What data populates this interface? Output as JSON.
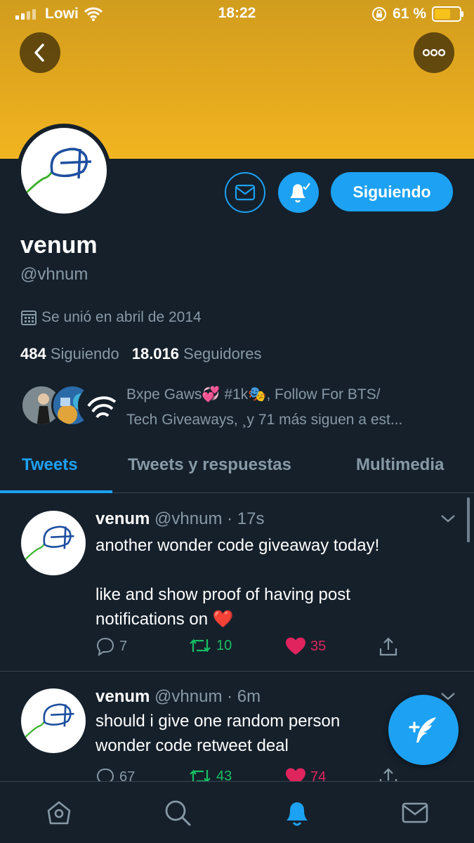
{
  "status": {
    "carrier": "Lowi",
    "time": "18:22",
    "battery": "61 %"
  },
  "profile": {
    "name": "venum",
    "handle": "@vhnum",
    "joined": "Se unió en abril de 2014",
    "following_count": "484",
    "following_label": "Siguiendo",
    "followers_count": "18.016",
    "followers_label": "Seguidores",
    "follow_button": "Siguiendo",
    "known_followers_line1": "Bxpe Gaws💞 #1k🎭, Follow For BTS/",
    "known_followers_line2": "Tech Giveaways, ¸y 71 más siguen a est..."
  },
  "tabs": [
    {
      "label": "Tweets",
      "active": true
    },
    {
      "label": "Tweets y respuestas",
      "active": false
    },
    {
      "label": "Multimedia",
      "active": false
    }
  ],
  "tweets": [
    {
      "name": "venum",
      "handle": "@vhnum",
      "time": "· 17s",
      "line1": "another wonder code giveaway today!",
      "line2": "like and show proof of having post",
      "line3": "notifications on ❤️",
      "replies": "7",
      "retweets": "10",
      "likes": "35"
    },
    {
      "name": "venum",
      "handle": "@vhnum",
      "time": "· 6m",
      "line1": "should i give one random person",
      "line2": "wonder code retweet deal",
      "replies": "67",
      "retweets": "43",
      "likes": "74"
    }
  ],
  "icons": {
    "back": "back-arrow-icon",
    "more": "more-options-icon",
    "message": "envelope-icon",
    "notify": "bell-icon",
    "compose": "compose-tweet-icon"
  },
  "colors": {
    "accent": "#1da1f2",
    "background": "#15202b",
    "muted": "#8899a6",
    "retweet": "#17bf63",
    "like": "#e0245e",
    "banner": "#e4a81e"
  }
}
